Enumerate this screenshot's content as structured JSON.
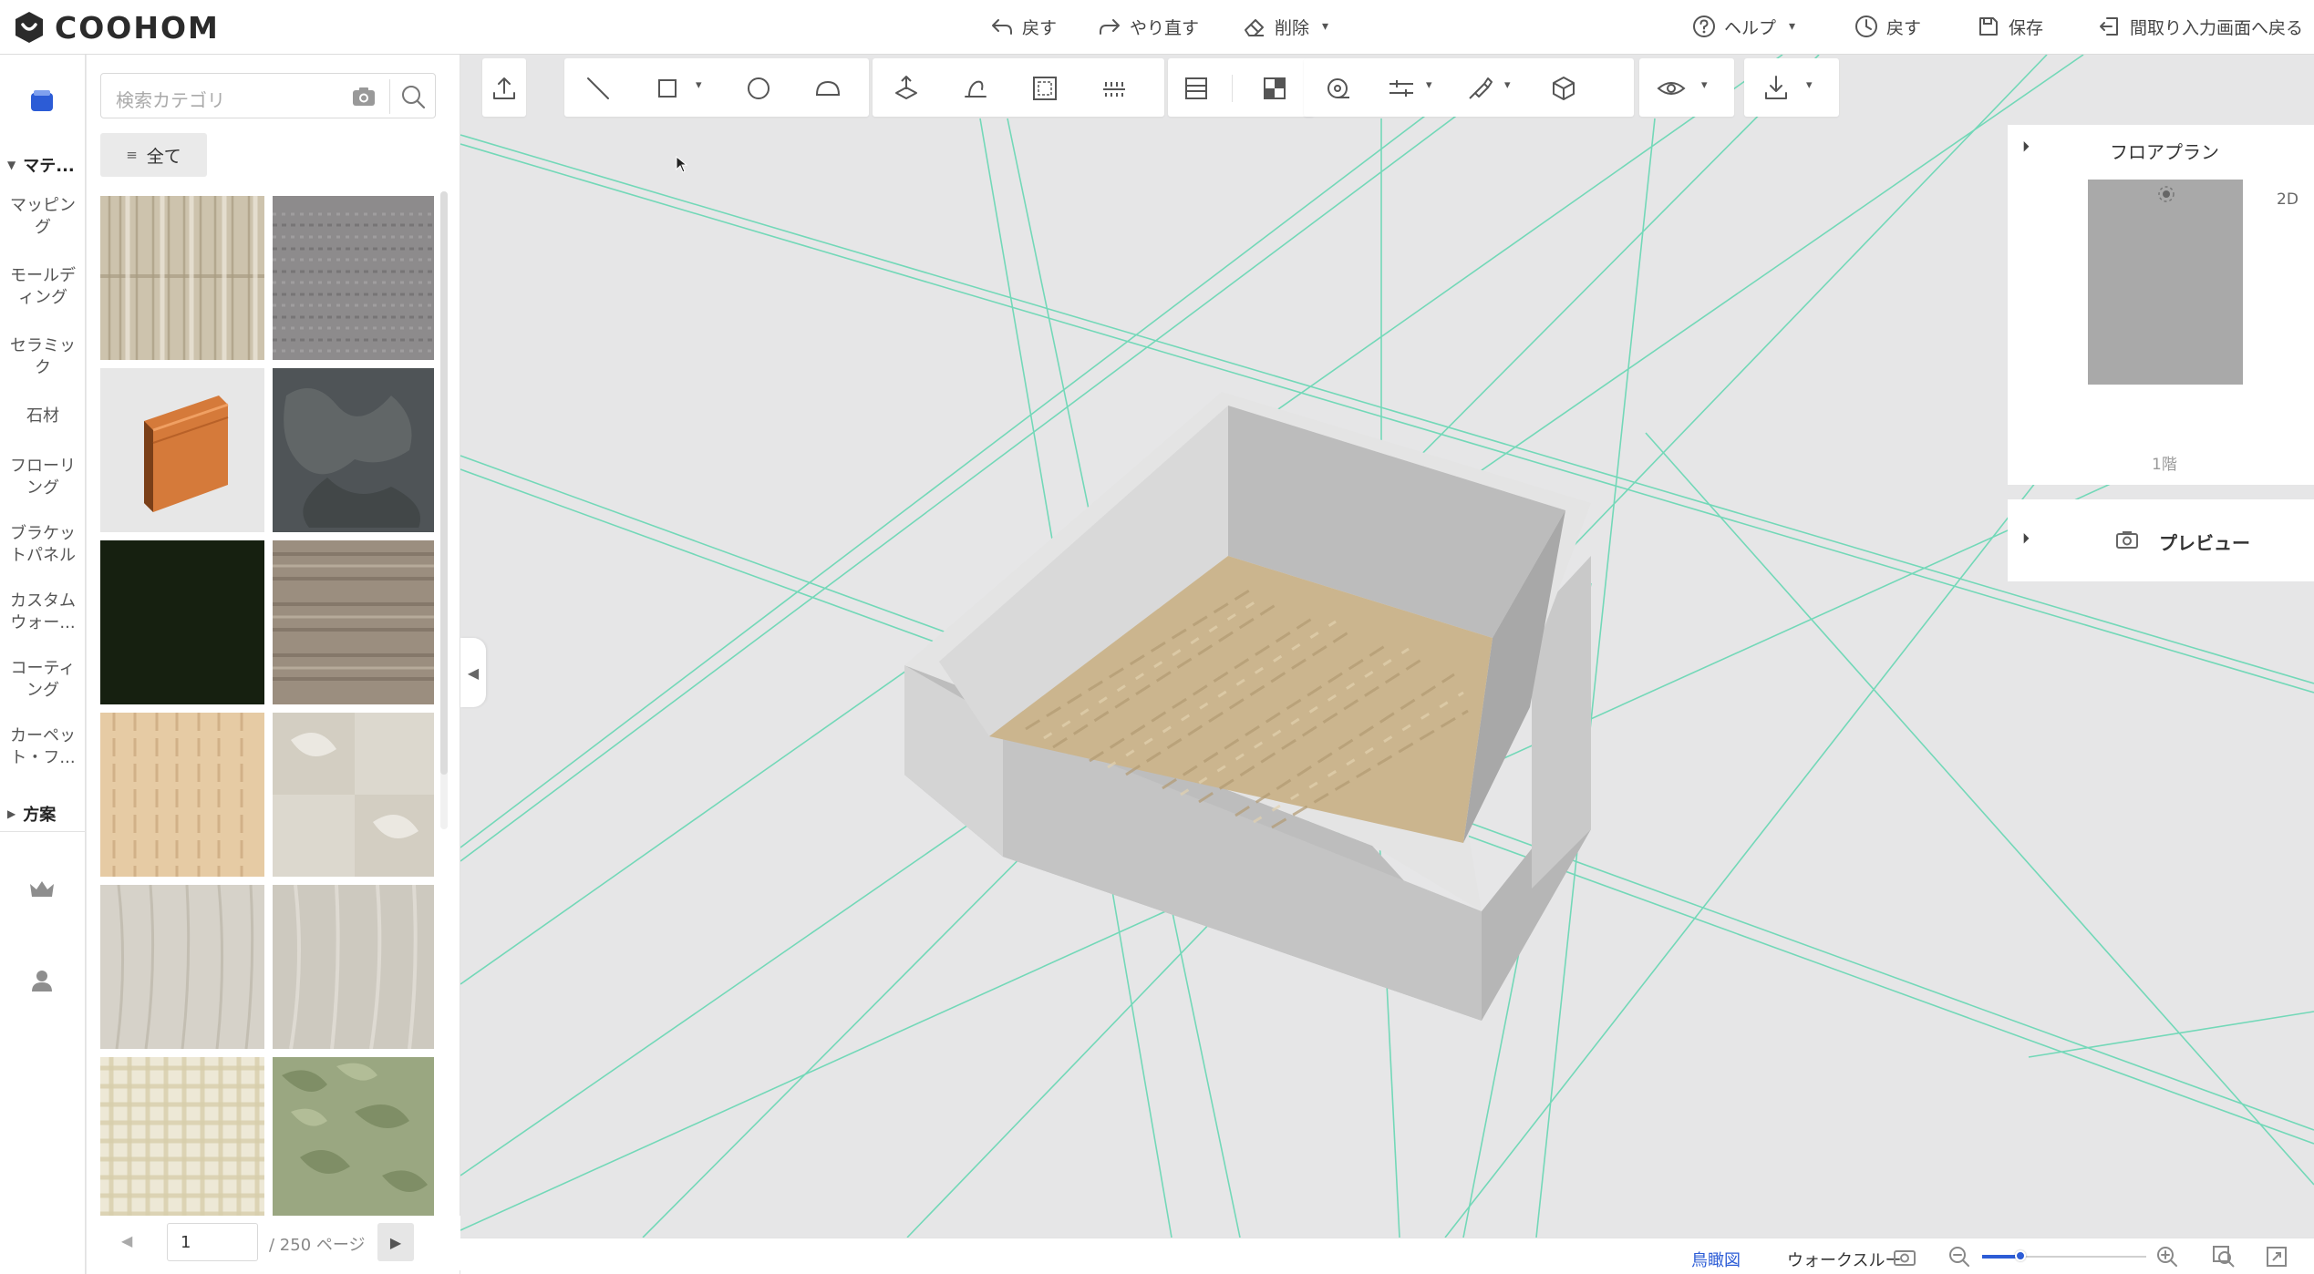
{
  "app": {
    "brand": "COOHOM"
  },
  "toolbar": {
    "undo": "戻す",
    "redo": "やり直す",
    "delete": "削除",
    "help": "ヘルプ",
    "history": "戻す",
    "save": "保存",
    "back_to_floorplan": "間取り入力画面へ戻る"
  },
  "sidebar": {
    "group_materials": "マテ...",
    "items": [
      {
        "label": "マッピング"
      },
      {
        "label": "モールディング"
      },
      {
        "label": "セラミック"
      },
      {
        "label": "石材"
      },
      {
        "label": "フローリング"
      },
      {
        "label": "ブラケットパネル"
      },
      {
        "label": "カスタムウォー..."
      },
      {
        "label": "コーティング"
      },
      {
        "label": "カーペット・フ..."
      }
    ],
    "group_plans": "方案",
    "extra_icons": [
      "crown-icon",
      "user-icon"
    ]
  },
  "catalog": {
    "search_placeholder": "検索カテゴリ",
    "filter_all": "全て",
    "tiles": [
      {
        "name": "light-wood-panel",
        "color": "#cfc6b2"
      },
      {
        "name": "gray-carpet",
        "color": "#8d8b8c"
      },
      {
        "name": "orange-baseboard",
        "color": "#e6e6e6"
      },
      {
        "name": "dark-stone",
        "color": "#4e5356"
      },
      {
        "name": "dark-green",
        "color": "#172011"
      },
      {
        "name": "brown-wood",
        "color": "#9c8f80"
      },
      {
        "name": "beige-wood",
        "color": "#e6cba5"
      },
      {
        "name": "pale-marble",
        "color": "#ddd9cf"
      },
      {
        "name": "light-grain",
        "color": "#d5d0c6"
      },
      {
        "name": "light-stone",
        "color": "#ccc8be"
      },
      {
        "name": "cream-plaid",
        "color": "#ece7d4"
      },
      {
        "name": "green-stone",
        "color": "#9aa882"
      }
    ],
    "pager": {
      "page": "1",
      "total": "/ 250 ページ"
    }
  },
  "right_panel": {
    "floorplan_title": "フロアプラン",
    "view_2d": "2D",
    "floor_label": "1階",
    "preview_title": "プレビュー"
  },
  "status_bar": {
    "bird_view": "鳥瞰図",
    "walkthrough": "ウォークスルー"
  },
  "colors": {
    "accent": "#2c5cd6",
    "guide_line": "#5fd6b0",
    "wall": "#c9c9c9",
    "floor": "#cbb58e"
  }
}
